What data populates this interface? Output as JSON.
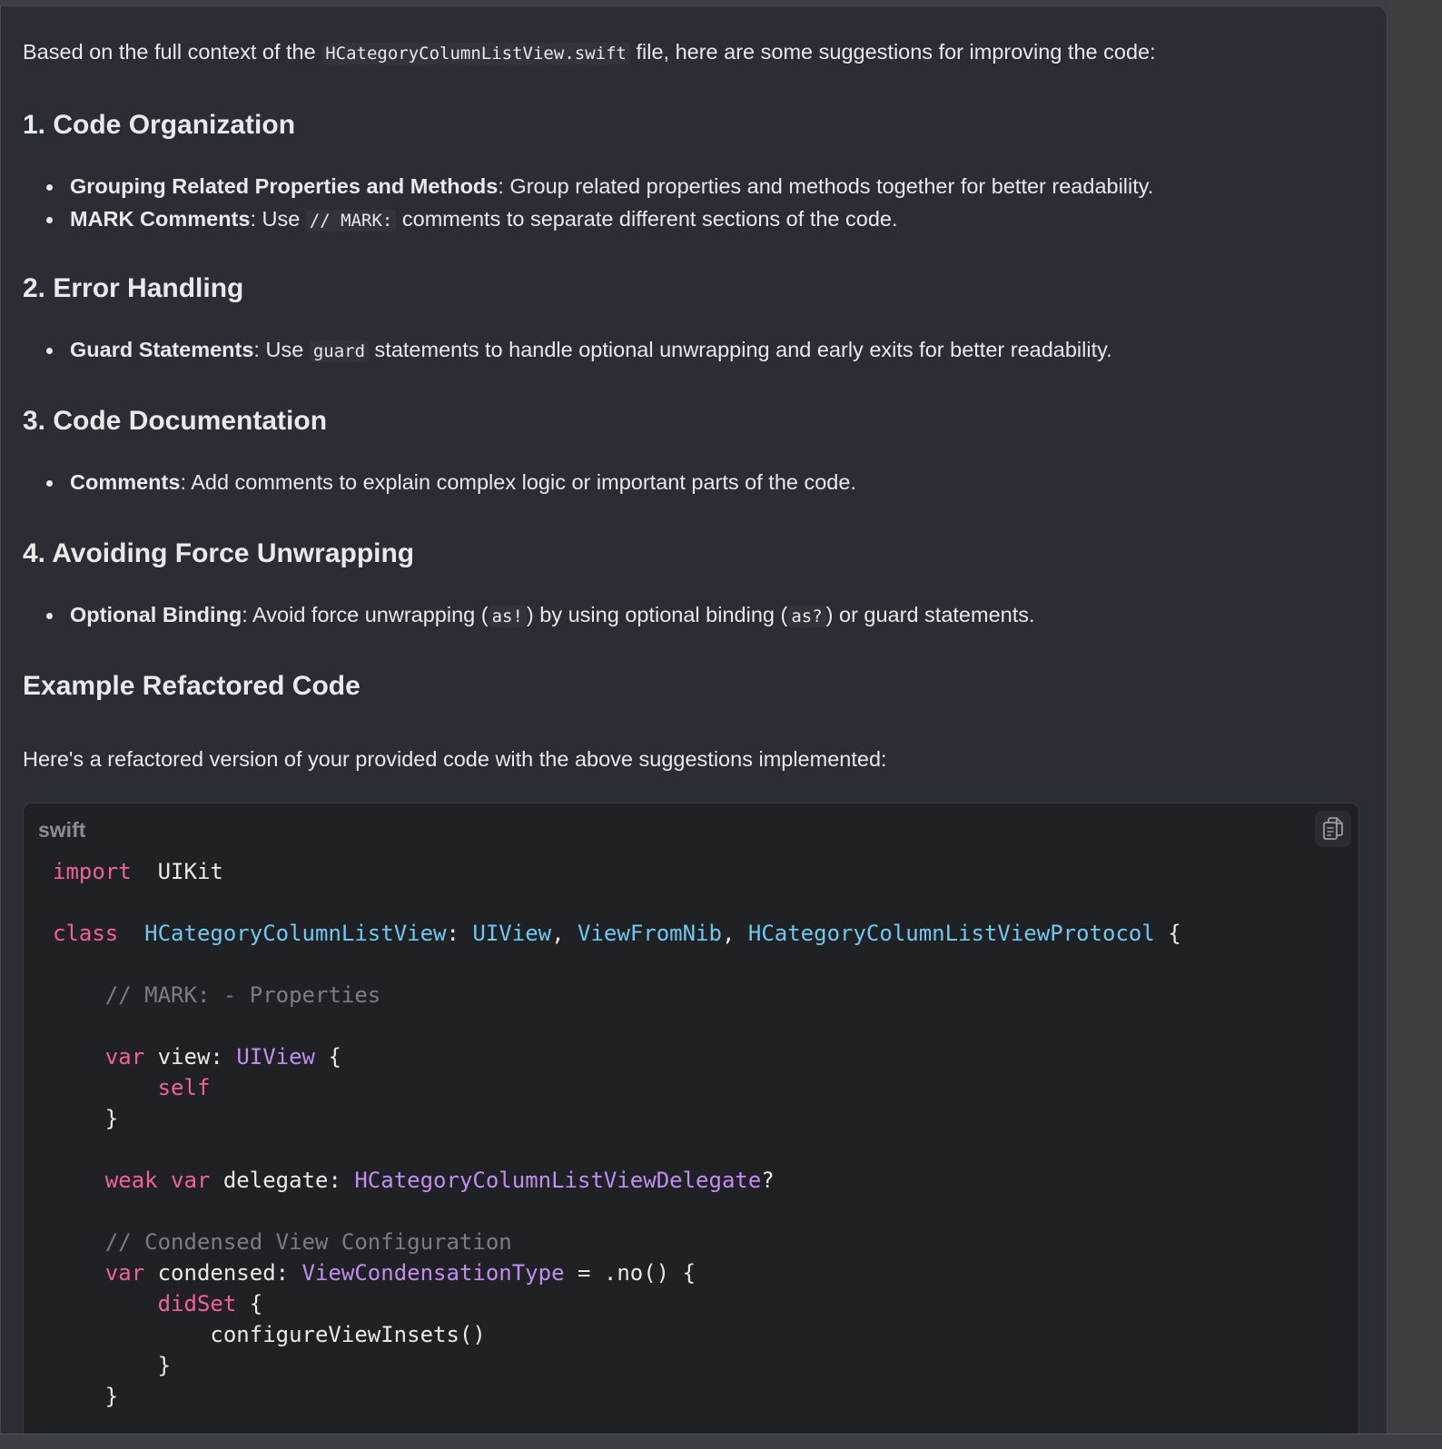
{
  "intro": {
    "prefix": "Based on the full context of the ",
    "file": "HCategoryColumnListView.swift",
    "suffix": " file, here are some suggestions for improving the code:"
  },
  "sections": [
    {
      "title": "1. Code Organization",
      "items": [
        {
          "bold": "Grouping Related Properties and Methods",
          "parts": [
            ": Group related properties and methods together for better readability."
          ]
        },
        {
          "bold": "MARK Comments",
          "parts": [
            ": Use ",
            "// MARK:",
            " comments to separate different sections of the code."
          ]
        }
      ]
    },
    {
      "title": "2. Error Handling",
      "items": [
        {
          "bold": "Guard Statements",
          "parts": [
            ": Use ",
            "guard",
            " statements to handle optional unwrapping and early exits for better readability."
          ]
        }
      ]
    },
    {
      "title": "3. Code Documentation",
      "items": [
        {
          "bold": "Comments",
          "parts": [
            ": Add comments to explain complex logic or important parts of the code."
          ]
        }
      ]
    },
    {
      "title": "4. Avoiding Force Unwrapping",
      "items": [
        {
          "bold": "Optional Binding",
          "parts": [
            ": Avoid force unwrapping (",
            "as!",
            ") by using optional binding (",
            "as?",
            ") or guard statements."
          ]
        }
      ]
    }
  ],
  "example": {
    "title": "Example Refactored Code",
    "lead": "Here's a refactored version of your provided code with the above suggestions implemented:"
  },
  "codeblock": {
    "language": "swift",
    "copy_icon": "copy-icon",
    "lines": [
      [
        [
          "kw",
          "import"
        ],
        [
          "",
          "  UIKit"
        ]
      ],
      [],
      [
        [
          "kw",
          "class"
        ],
        [
          "",
          "  "
        ],
        [
          "ty",
          "HCategoryColumnListView"
        ],
        [
          "",
          ": "
        ],
        [
          "ty",
          "UIView"
        ],
        [
          "",
          ", "
        ],
        [
          "ty",
          "ViewFromNib"
        ],
        [
          "",
          ", "
        ],
        [
          "ty",
          "HCategoryColumnListViewProtocol"
        ],
        [
          "",
          " {"
        ]
      ],
      [],
      [
        [
          "",
          "    "
        ],
        [
          "cm",
          "// MARK: - Properties"
        ]
      ],
      [],
      [
        [
          "",
          "    "
        ],
        [
          "kw",
          "var"
        ],
        [
          "",
          " view: "
        ],
        [
          "tyv",
          "UIView"
        ],
        [
          "",
          " {"
        ]
      ],
      [
        [
          "",
          "        "
        ],
        [
          "kw",
          "self"
        ]
      ],
      [
        [
          "",
          "    }"
        ]
      ],
      [],
      [
        [
          "",
          "    "
        ],
        [
          "kw",
          "weak"
        ],
        [
          "",
          " "
        ],
        [
          "kw",
          "var"
        ],
        [
          "",
          " delegate: "
        ],
        [
          "tyv",
          "HCategoryColumnListViewDelegate"
        ],
        [
          "",
          "?"
        ]
      ],
      [],
      [
        [
          "",
          "    "
        ],
        [
          "cm",
          "// Condensed View Configuration"
        ]
      ],
      [
        [
          "",
          "    "
        ],
        [
          "kw",
          "var"
        ],
        [
          "",
          " condensed: "
        ],
        [
          "tyv",
          "ViewCondensationType"
        ],
        [
          "",
          " = .no() {"
        ]
      ],
      [
        [
          "",
          "        "
        ],
        [
          "kw",
          "didSet"
        ],
        [
          "",
          " {"
        ]
      ],
      [
        [
          "",
          "            configureViewInsets()"
        ]
      ],
      [
        [
          "",
          "        }"
        ]
      ],
      [
        [
          "",
          "    }"
        ]
      ]
    ]
  }
}
